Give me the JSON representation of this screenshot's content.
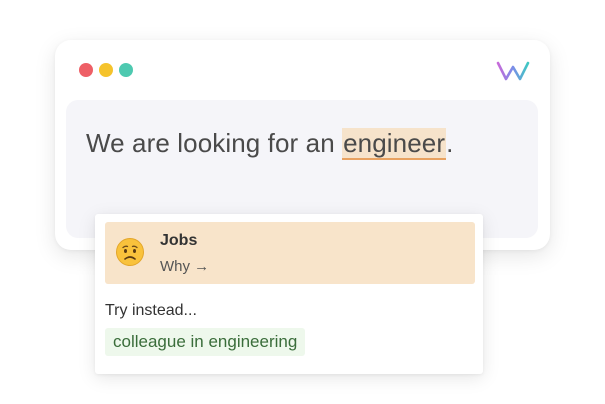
{
  "window": {
    "controls": [
      "close",
      "minimize",
      "maximize"
    ],
    "logo_icon": "brand-logo-icon"
  },
  "editor": {
    "text_before": "We are looking for an ",
    "flagged_word": "engineer",
    "text_after": "."
  },
  "popover": {
    "issue": {
      "emoji_icon": "worried-face-icon",
      "title": "Jobs",
      "why_link": "Why →"
    },
    "try_instead_label": "Try instead...",
    "suggestion": "colleague in engineering"
  },
  "colors": {
    "close_dot": "#ee5f66",
    "minimize_dot": "#f5c32c",
    "maximize_dot": "#4ec9b0",
    "highlight_bg": "#f6e3cb",
    "highlight_underline": "#e8a261",
    "issue_card_bg": "#f8e4ca",
    "suggestion_bg": "#eef8ec",
    "suggestion_text": "#3a6d3a"
  }
}
